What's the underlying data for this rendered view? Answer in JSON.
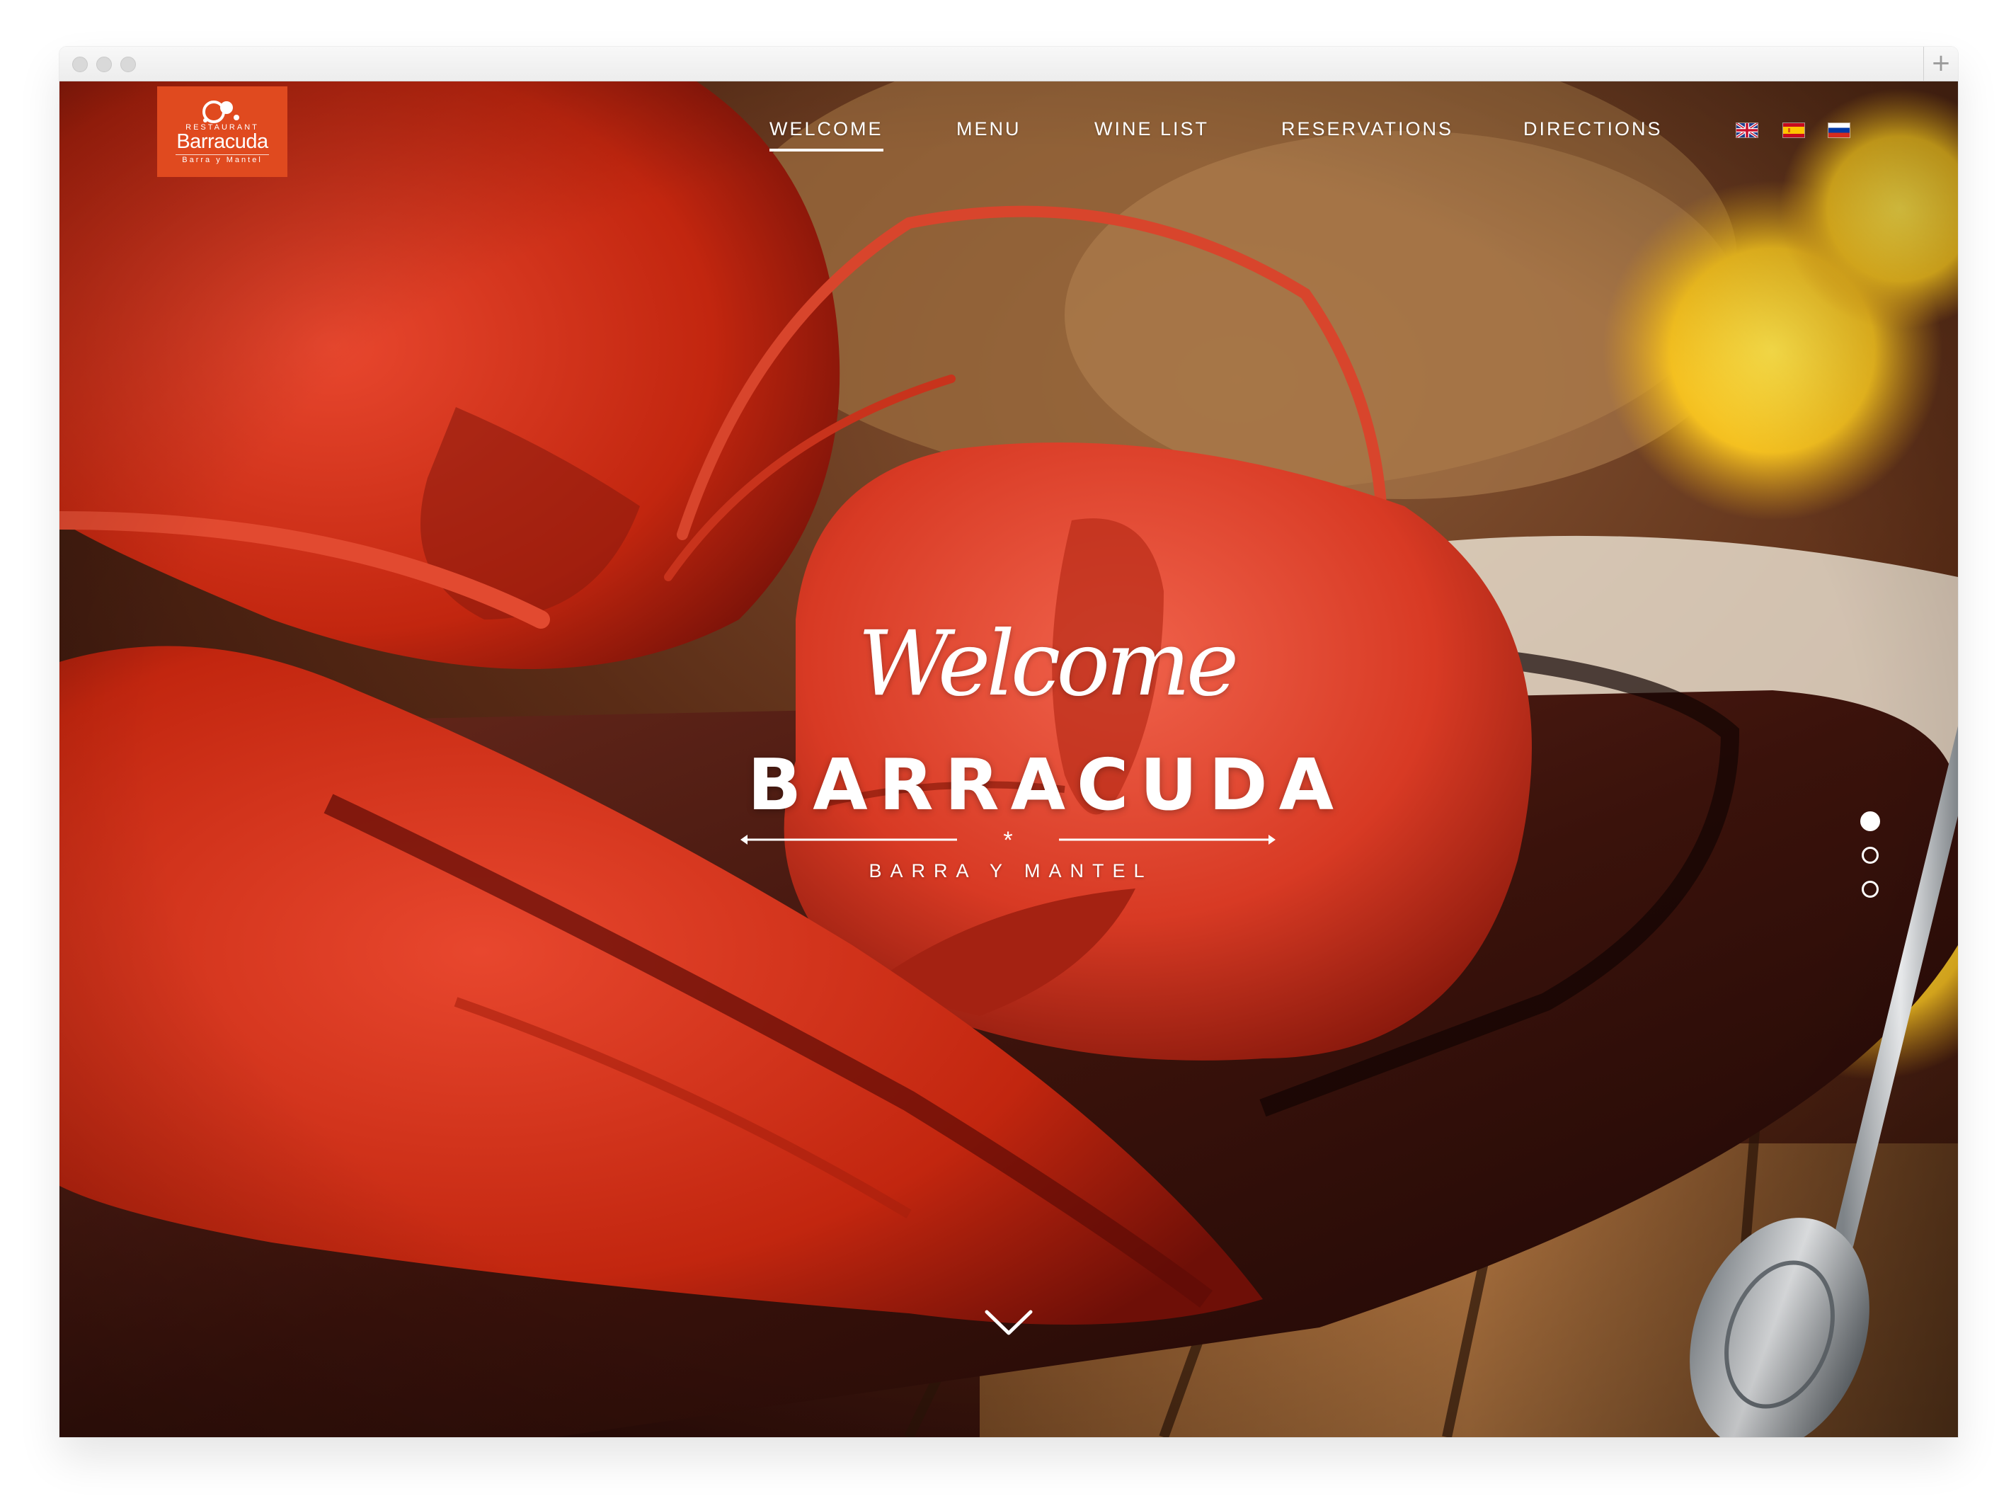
{
  "site": {
    "logo": {
      "top_tag": "RESTAURANT",
      "brand": "Barracuda",
      "bottom_tag": "Barra y Mantel",
      "color": "#e04a1f"
    },
    "nav": {
      "items": [
        {
          "label": "WELCOME",
          "active": true
        },
        {
          "label": "MENU",
          "active": false
        },
        {
          "label": "WINE LIST",
          "active": false
        },
        {
          "label": "RESERVATIONS",
          "active": false
        },
        {
          "label": "DIRECTIONS",
          "active": false
        }
      ],
      "languages": [
        {
          "name": "english-flag-icon"
        },
        {
          "name": "spanish-flag-icon"
        },
        {
          "name": "russian-flag-icon"
        }
      ]
    },
    "hero": {
      "script_title": "Welcome",
      "title": "BARRACUDA",
      "divider_glyph": "*",
      "subtitle": "BARRA Y MANTEL",
      "slides": {
        "count": 3,
        "active_index": 0
      },
      "scroll_icon": "chevron-down-icon"
    }
  },
  "browser": {
    "new_tab_label": "+"
  }
}
